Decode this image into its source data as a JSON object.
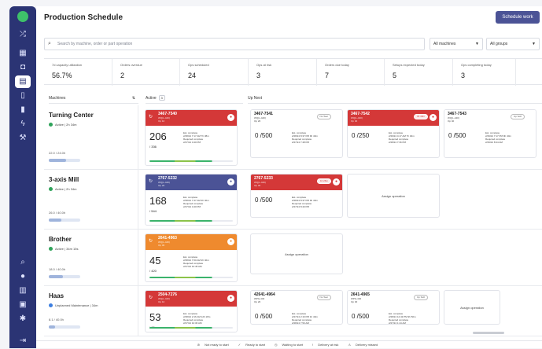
{
  "header": {
    "title": "Production Schedule",
    "schedule_btn": "Schedule work"
  },
  "search": {
    "placeholder": "Search by machine, order or part operation"
  },
  "filters": {
    "machines": "All machines",
    "groups": "All groups"
  },
  "stats": [
    {
      "label": "7d capacity utilization",
      "value": "56.7%"
    },
    {
      "label": "Orders overdue",
      "value": "2"
    },
    {
      "label": "Ops scheduled",
      "value": "24"
    },
    {
      "label": "Ops at risk",
      "value": "3"
    },
    {
      "label": "Orders due today",
      "value": "7"
    },
    {
      "label": "Setups expected today",
      "value": "5"
    },
    {
      "label": "Ops completing today",
      "value": "3"
    }
  ],
  "columns": {
    "machines": "Machines",
    "active": "Active",
    "active_count": "3",
    "up_next": "Up Next"
  },
  "machines": [
    {
      "name": "Turning Center",
      "status": "Active | 2h 34m",
      "hours": "22.0 / 24.0h",
      "status_color": "#2fa35a",
      "utilization": 0.55,
      "active": {
        "order": "3467-7540",
        "part": "WQ(L-440)",
        "op": "Op 10",
        "done": "206",
        "total": "/ 336",
        "complete_label": "Est. complete",
        "complete": "2/28/24 7:17 AM  7h 38m",
        "req_label": "Required complete",
        "req": "2/27/24 4:40 PM",
        "color": "#d43838"
      },
      "next": [
        {
          "order": "3467-7541",
          "part": "WQ(L-440)",
          "op": "Op 20",
          "qty": "0 /500",
          "pill": "No Tear",
          "complete": "2/28/24 8:37 PM  9h 40m",
          "req": "2/27/24 7:48 PM",
          "color": "#ffffff"
        },
        {
          "order": "3467-7542",
          "part": "WQ(L-440)",
          "op": "Op 30",
          "qty": "0 /250",
          "pill": "3h 40m",
          "complete": "2/29/24 4:17 AM  7h 40m",
          "req": "2/28/24 7:36 PM",
          "color": "#d43838"
        },
        {
          "order": "3467-7543",
          "part": "WQ(L-440)",
          "op": "Op 40",
          "qty": "0 /500",
          "pill": "Up Soft",
          "complete": "2/29/24 7:17 PM  9h 40m",
          "req": "2/29/24 8:44 AM",
          "color": "#ffffff"
        }
      ]
    },
    {
      "name": "3-axis Mill",
      "status": "Active | 2h 34m",
      "hours": "26.0 / 40.0h",
      "status_color": "#2fa35a",
      "utilization": 0.4,
      "active": {
        "order": "2767-5232",
        "part": "WQ(L-440)",
        "op": "Op 20",
        "done": "168",
        "total": "/ 544",
        "complete_label": "Est. complete",
        "complete": "2/28/24 7:47 AM  3h 40m",
        "req_label": "Required complete",
        "req": "2/27/24 4:40 PM",
        "color": "#4b5396"
      },
      "next": [
        {
          "order": "2767-5233",
          "part": "WQ(L-440)",
          "op": "Op 30",
          "qty": "0 /500",
          "pill": "1h 26m",
          "complete": "2/28/24 8:37 PM  9h 40m",
          "req": "2/27/24 8:40 PM",
          "color": "#d43838"
        }
      ],
      "assign": "Assign operation"
    },
    {
      "name": "Brother",
      "status": "Active | 34m 15s",
      "hours": "18.0 / 40.0h",
      "status_color": "#2fa35a",
      "utilization": 0.45,
      "active": {
        "order": "2641-4963",
        "part": "WQ(L-440)",
        "op": "Op 30",
        "done": "45",
        "total": "/ 420",
        "complete_label": "Est. complete",
        "complete": "2/28/24 7:00 AM  2h 40m",
        "req_label": "Required complete",
        "req": "2/27/24 10:45 AM",
        "color": "#ef8a2e"
      },
      "assign": "Assign operation"
    },
    {
      "name": "Haas",
      "status": "Unplanned Maintenance | 34m",
      "hours": "8.1 / 40.0h",
      "status_color": "#3d7ee0",
      "utilization": 0.2,
      "active": {
        "order": "2504-7276",
        "part": "WQ(L-440)",
        "op": "Op 10",
        "done": "53",
        "total": "/ 60",
        "complete_label": "Est. complete",
        "complete": "2/28/24 2:16 AM  12h 18m",
        "req_label": "Required complete",
        "req": "2/27/24 10:30 AM",
        "color": "#d43838"
      },
      "next": [
        {
          "order": "42641-4964",
          "part": "WPG-440",
          "op": "Op 20",
          "qty": "0 /500",
          "pill": "No Tear",
          "complete": "2/27/24 2:16 PM  1h 40m",
          "req": "2/28/24 7:50 AM",
          "color": "#ffffff"
        },
        {
          "order": "2641-4965",
          "part": "WPG-440",
          "op": "Op 30",
          "qty": "0 /500",
          "pill": "Up Soft",
          "complete": "2/28/24 12:43 PM  9h 50m",
          "req": "2/27/24 1:44 AM",
          "color": "#ffffff"
        }
      ],
      "assign": "Assign operation"
    }
  ],
  "legend": [
    "Not ready to start",
    "Ready to start",
    "Waiting to start",
    "Delivery at risk",
    "Delivery missed"
  ]
}
